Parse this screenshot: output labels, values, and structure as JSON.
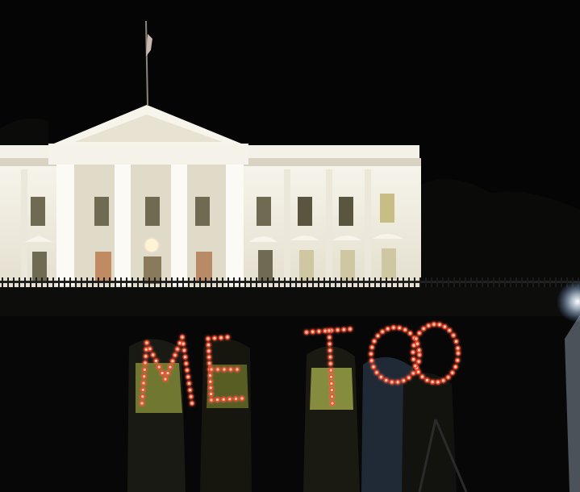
{
  "scene": {
    "description_hidden": "",
    "sign_letters": [
      "M",
      "E",
      "T",
      "O",
      "O"
    ],
    "colors": {
      "sky": "#050505",
      "building": "#f2f0e6",
      "building_shadow": "#c9c4b4",
      "window": "#6f6a52",
      "window_lit": "#e8c98a",
      "fence": "#141414",
      "hedge": "#0d0d0c",
      "bulb": "#ffd7a8",
      "bulb_glow": "#ff3b2a",
      "vest": "#d7e35a",
      "flag": "#c9b7b0",
      "spotlight": "#e8f2ff"
    }
  }
}
